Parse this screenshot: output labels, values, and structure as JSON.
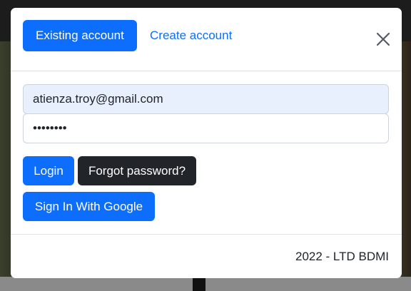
{
  "modal": {
    "tabs": {
      "existing_label": "Existing account",
      "create_label": "Create account"
    },
    "close_icon": "close-icon",
    "form": {
      "email_value": "atienza.troy@gmail.com",
      "password_value": "password"
    },
    "buttons": {
      "login_label": "Login",
      "forgot_label": "Forgot password?",
      "google_label": "Sign In With Google"
    },
    "footer_text": "2022 - LTD BDMI"
  },
  "colors": {
    "primary": "#0d6efd",
    "dark": "#212529",
    "autofill_background": "#e8f0fe"
  }
}
